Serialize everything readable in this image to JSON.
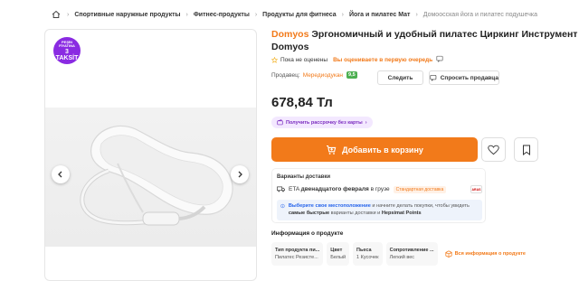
{
  "breadcrumb": {
    "items": [
      "Спортивные наружные продукты",
      "Фитнес-продукты",
      "Продукты для фитнеса",
      "Йога и пилатес Мат"
    ],
    "current": "Домоосская йога и пилатес подушечка"
  },
  "badge": {
    "line1": "PEŞİN",
    "line2": "FİYATINA",
    "line3": "3 TAKSİT"
  },
  "product": {
    "brand": "Domyos",
    "title": "Эргономичный и удобный пилатес Циркинг Инструмент Domyos",
    "rating_text": "Пока не оценены",
    "rating_link": "Вы оцениваете в первую очередь",
    "price": "678,84 Тл"
  },
  "seller": {
    "label": "Продавец:",
    "name": "Мередиодукан",
    "score": "9,5",
    "follow_label": "Следить",
    "ask_label": "Спросить продавца"
  },
  "installment": {
    "label": "Получить рассрочку без карты"
  },
  "cart": {
    "label": "Добавить в корзину"
  },
  "delivery": {
    "header": "Варианты доставки",
    "eta_prefix": "ETA",
    "eta_bold": "двенадцатого февраля",
    "eta_suffix": "в грузе",
    "tag": "Стандартная доставка",
    "logo": "ARAS",
    "info_hl": "Выберите свое местоположение",
    "info_mid": "и начните делать покупки, чтобы увидеть",
    "info_bold": "самые быстрые",
    "info_mid2": "варианты доставки и",
    "info_bold2": "Hepsimat Points"
  },
  "product_info": {
    "title": "Информация о продукте",
    "attributes": [
      {
        "key": "Тип продукта пи...",
        "value": "Пилатес Резисте..."
      },
      {
        "key": "Цвет",
        "value": "Белый"
      },
      {
        "key": "Пьеса",
        "value": "1 Кусочек"
      },
      {
        "key": "Сопротивление ...",
        "value": "Легкий вес"
      }
    ],
    "all_info_label": "Вся информация о продукте"
  },
  "colors": {
    "accent": "#f27a1a",
    "badge": "#8a2be2",
    "score": "#4caf50",
    "link": "#2563eb"
  }
}
